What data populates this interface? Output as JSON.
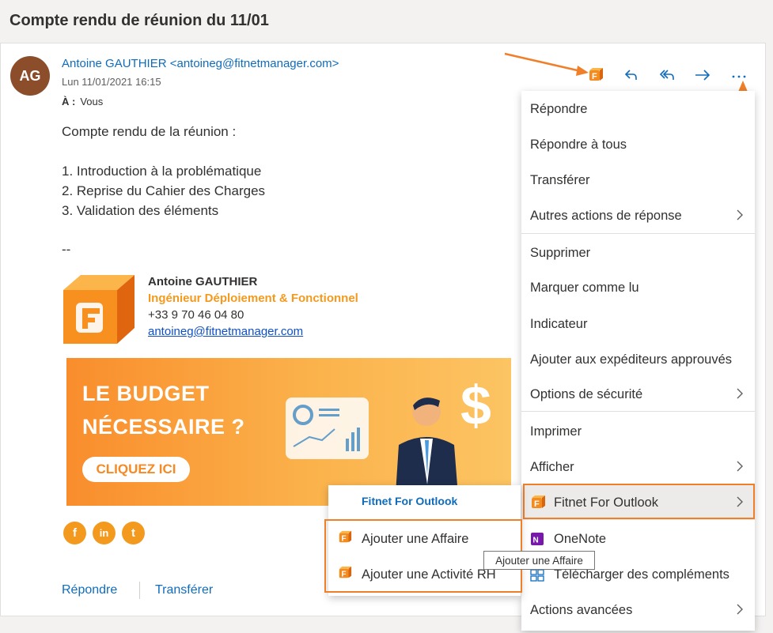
{
  "subject": "Compte rendu de réunion du 11/01",
  "email": {
    "avatar_initials": "AG",
    "sender": "Antoine GAUTHIER <antoineg@fitnetmanager.com>",
    "date": "Lun 11/01/2021 16:15",
    "to_label": "À :",
    "to_value": "Vous",
    "body_lines": [
      "Compte rendu de la réunion :",
      "1. Introduction à la problématique",
      "2. Reprise du Cahier des Charges",
      "3. Validation des éléments",
      "--"
    ]
  },
  "signature": {
    "name": "Antoine GAUTHIER",
    "title": "Ingénieur Déploiement & Fonctionnel",
    "phone": "+33 9 70 46 04 80",
    "email": "antoineg@fitnetmanager.com"
  },
  "banner": {
    "headline_1": "LE BUDGET",
    "headline_2": "NÉCESSAIRE ?",
    "button": "CLIQUEZ ICI"
  },
  "social": [
    "f",
    "in",
    "t"
  ],
  "footer": {
    "reply": "Répondre",
    "forward": "Transférer"
  },
  "menu": {
    "items": [
      "Répondre",
      "Répondre à tous",
      "Transférer",
      "Autres actions de réponse",
      "Supprimer",
      "Marquer comme lu",
      "Indicateur",
      "Ajouter aux expéditeurs approuvés",
      "Options de sécurité",
      "Imprimer",
      "Afficher",
      "Fitnet For Outlook",
      "OneNote",
      "Télécharger des compléments",
      "Actions avancées"
    ]
  },
  "submenu": {
    "header": "Fitnet For Outlook",
    "items": [
      "Ajouter une Affaire",
      "Ajouter une Activité RH"
    ]
  },
  "tooltip": "Ajouter une Affaire",
  "colors": {
    "accent": "#0f6cbd",
    "brand_orange": "#f39a1e",
    "highlight_box": "#f07f2a"
  }
}
